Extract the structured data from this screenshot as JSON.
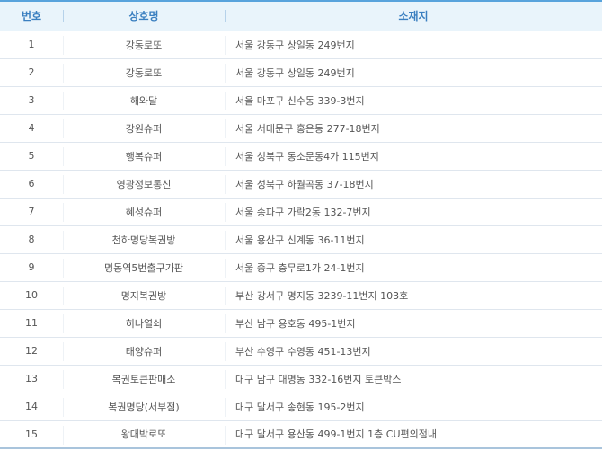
{
  "table": {
    "headers": {
      "no": "번호",
      "name": "상호명",
      "address": "소재지"
    },
    "rows": [
      {
        "no": "1",
        "name": "강동로또",
        "address": "서울 강동구 상일동 249번지"
      },
      {
        "no": "2",
        "name": "강동로또",
        "address": "서울 강동구 상일동 249번지"
      },
      {
        "no": "3",
        "name": "해와달",
        "address": "서울 마포구 신수동 339-3번지"
      },
      {
        "no": "4",
        "name": "강원슈퍼",
        "address": "서울 서대문구 홍은동 277-18번지"
      },
      {
        "no": "5",
        "name": "행복슈퍼",
        "address": "서울 성북구 동소문동4가 115번지"
      },
      {
        "no": "6",
        "name": "영광정보통신",
        "address": "서울 성북구 하월곡동 37-18번지"
      },
      {
        "no": "7",
        "name": "혜성슈퍼",
        "address": "서울 송파구 가락2동 132-7번지"
      },
      {
        "no": "8",
        "name": "천하명당복권방",
        "address": "서울 용산구 신계동 36-11번지"
      },
      {
        "no": "9",
        "name": "명동역5번출구가판",
        "address": "서울 중구 충무로1가 24-1번지"
      },
      {
        "no": "10",
        "name": "명지복권방",
        "address": "부산 강서구 명지동 3239-11번지 103호"
      },
      {
        "no": "11",
        "name": "히나열쇠",
        "address": "부산 남구 용호동 495-1번지"
      },
      {
        "no": "12",
        "name": "태양슈퍼",
        "address": "부산 수영구 수영동 451-13번지"
      },
      {
        "no": "13",
        "name": "복권토큰판매소",
        "address": "대구 남구 대명동 332-16번지 토큰박스"
      },
      {
        "no": "14",
        "name": "복권명당(서부점)",
        "address": "대구 달서구 송현동 195-2번지"
      },
      {
        "no": "15",
        "name": "왕대박로또",
        "address": "대구 달서구 용산동 499-1번지 1층 CU편의점내"
      }
    ]
  }
}
